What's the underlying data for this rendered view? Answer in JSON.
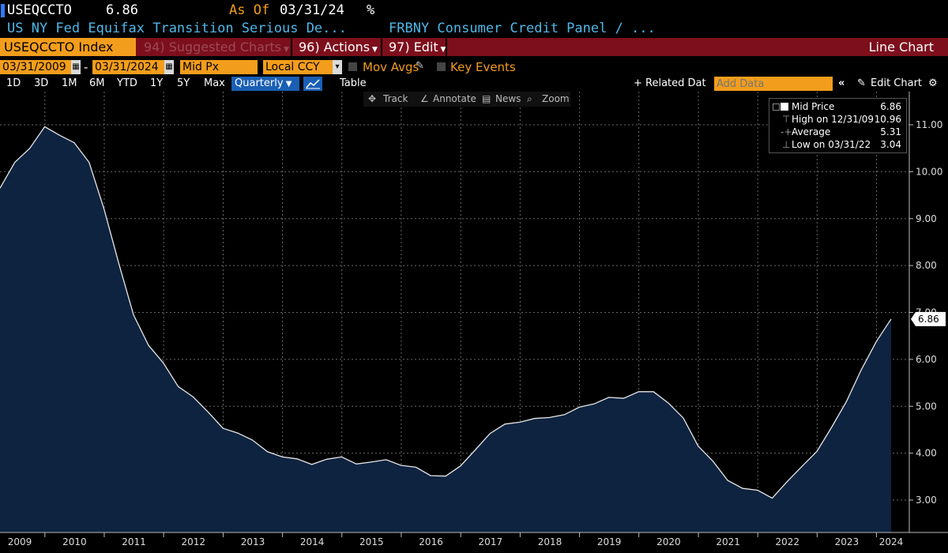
{
  "header": {
    "ticker": "USEQCCTO",
    "last_value": "6.86",
    "as_of_label": "As Of",
    "as_of_date": "03/31/24",
    "unit": "%",
    "description_1": "US NY Fed Equifax Transition Serious De...",
    "description_2": "FRBNY Consumer Credit Panel / ..."
  },
  "toolbar": {
    "security": "USEQCCTO Index",
    "suggested_charts": "94) Suggested Charts",
    "actions": "96) Actions",
    "edit": "97) Edit",
    "view_title": "Line Chart"
  },
  "controls": {
    "start_date": "03/31/2009",
    "end_date": "03/31/2024",
    "date_sep": "-",
    "price_field": "Mid Px",
    "currency": "Local CCY",
    "mov_avgs": "Mov Avgs",
    "key_events": "Key Events"
  },
  "ranges": {
    "buttons": [
      "1D",
      "3D",
      "1M",
      "6M",
      "YTD",
      "1Y",
      "5Y",
      "Max"
    ],
    "periodicity": "Quarterly",
    "table": "Table",
    "related_data": "+ Related Dat",
    "add_data_placeholder": "Add Data",
    "edit_chart": "Edit Chart"
  },
  "chart_tools": {
    "track": "Track",
    "annotate": "Annotate",
    "news": "News",
    "zoom": "Zoom"
  },
  "legend": {
    "series": "Mid Price",
    "series_value": "6.86",
    "high_label": "High on 12/31/09",
    "high_value": "10.96",
    "avg_label": "Average",
    "avg_value": "5.31",
    "low_label": "Low on 03/31/22",
    "low_value": "3.04"
  },
  "colors": {
    "accent_orange": "#f39d1c",
    "header_red": "#7d0f1c",
    "link_blue": "#4fb8e8",
    "area_fill": "#0e2340",
    "line": "#e6e6e6"
  },
  "chart_data": {
    "type": "area",
    "ylim": [
      2.4,
      11.7
    ],
    "y_ticks": [
      "3.00",
      "4.00",
      "5.00",
      "6.00",
      "7.00",
      "8.00",
      "9.00",
      "10.00",
      "11.00"
    ],
    "x_tick_labels": [
      "2009",
      "2010",
      "2011",
      "2012",
      "2013",
      "2014",
      "2015",
      "2016",
      "2017",
      "2018",
      "2019",
      "2020",
      "2021",
      "2022",
      "2023",
      "2024"
    ],
    "last_value_label": "6.86",
    "grid": true,
    "legend_position": "top-right",
    "x": [
      "03/31/2009",
      "06/30/2009",
      "09/30/2009",
      "12/31/2009",
      "03/31/2010",
      "06/30/2010",
      "09/30/2010",
      "12/31/2010",
      "03/31/2011",
      "06/30/2011",
      "09/30/2011",
      "12/31/2011",
      "03/31/2012",
      "06/30/2012",
      "09/30/2012",
      "12/31/2012",
      "03/31/2013",
      "06/30/2013",
      "09/30/2013",
      "12/31/2013",
      "03/31/2014",
      "06/30/2014",
      "09/30/2014",
      "12/31/2014",
      "03/31/2015",
      "06/30/2015",
      "09/30/2015",
      "12/31/2015",
      "03/31/2016",
      "06/30/2016",
      "09/30/2016",
      "12/31/2016",
      "03/31/2017",
      "06/30/2017",
      "09/30/2017",
      "12/31/2017",
      "03/31/2018",
      "06/30/2018",
      "09/30/2018",
      "12/31/2018",
      "03/31/2019",
      "06/30/2019",
      "09/30/2019",
      "12/31/2019",
      "03/31/2020",
      "06/30/2020",
      "09/30/2020",
      "12/31/2020",
      "03/31/2021",
      "06/30/2021",
      "09/30/2021",
      "12/31/2021",
      "03/31/2022",
      "06/30/2022",
      "09/30/2022",
      "12/31/2022",
      "03/31/2023",
      "06/30/2023",
      "09/30/2023",
      "12/31/2023",
      "03/31/2024"
    ],
    "series": [
      {
        "name": "Mid Price",
        "values": [
          9.65,
          10.2,
          10.5,
          10.96,
          10.78,
          10.62,
          10.2,
          9.2,
          8.05,
          6.95,
          6.3,
          5.92,
          5.42,
          5.2,
          4.88,
          4.53,
          4.43,
          4.28,
          4.03,
          3.92,
          3.88,
          3.76,
          3.87,
          3.92,
          3.77,
          3.81,
          3.86,
          3.74,
          3.7,
          3.52,
          3.51,
          3.73,
          4.07,
          4.42,
          4.62,
          4.66,
          4.74,
          4.76,
          4.82,
          4.98,
          5.05,
          5.19,
          5.17,
          5.31,
          5.31,
          5.07,
          4.75,
          4.15,
          3.83,
          3.42,
          3.25,
          3.21,
          3.04,
          3.39,
          3.72,
          4.04,
          4.55,
          5.1,
          5.78,
          6.38,
          6.86
        ]
      }
    ]
  }
}
